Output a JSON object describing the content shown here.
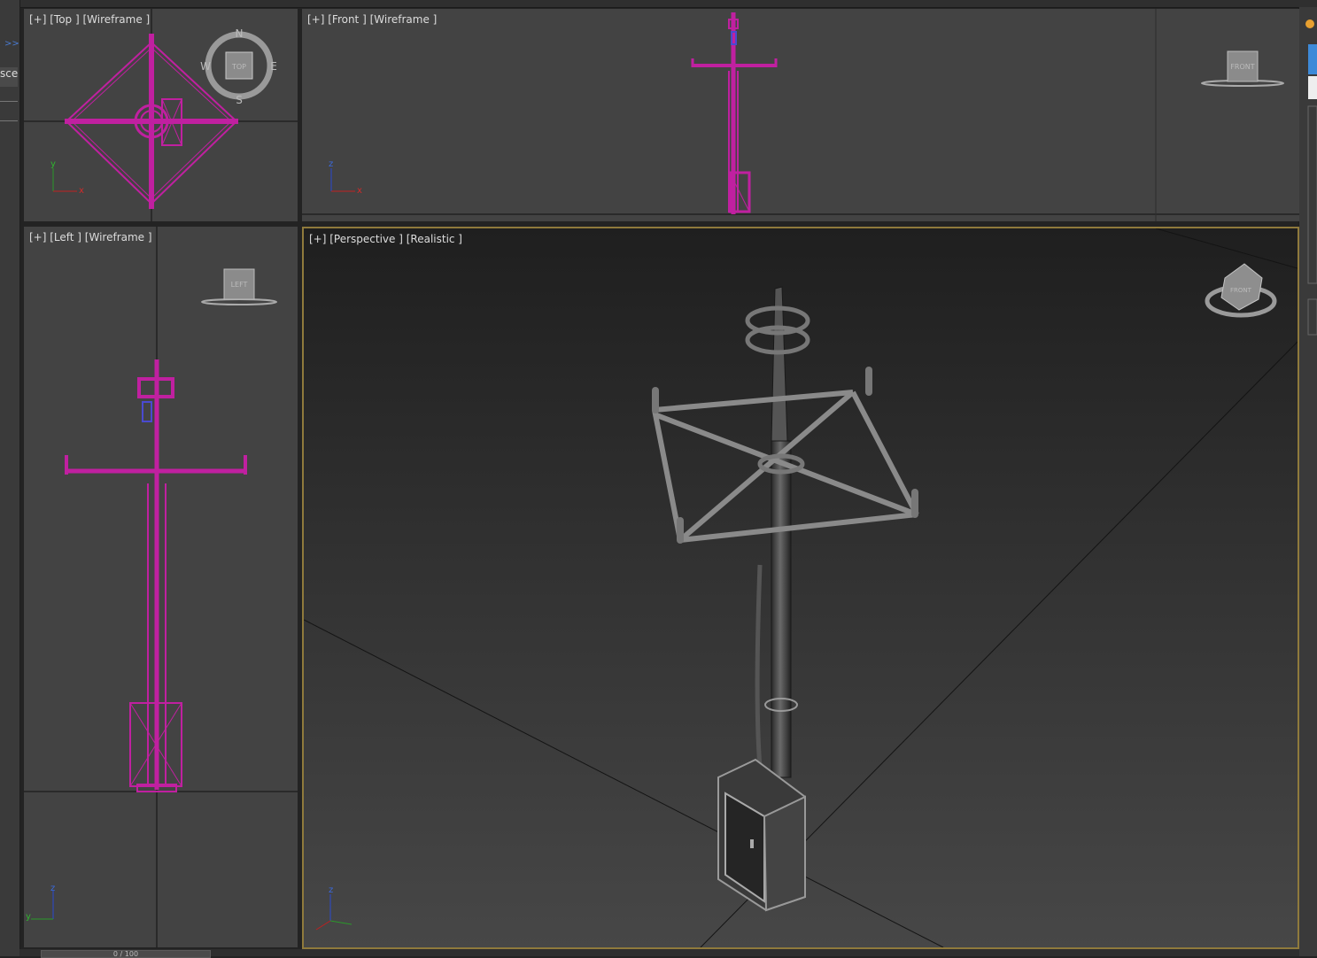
{
  "viewports": {
    "top": {
      "label": "[+] [Top ] [Wireframe ]",
      "gizmo": "TOP",
      "compass": {
        "n": "N",
        "s": "S",
        "e": "E",
        "w": "W"
      },
      "axes": {
        "up": "y",
        "right": "x"
      }
    },
    "front": {
      "label": "[+] [Front ] [Wireframe ]",
      "gizmo": "FRONT",
      "axes": {
        "up": "z",
        "right": "x"
      }
    },
    "left": {
      "label": "[+] [Left ] [Wireframe ]",
      "gizmo": "LEFT",
      "axes": {
        "up": "z",
        "right": "y"
      }
    },
    "perspective": {
      "label": "[+] [Perspective ] [Realistic ]",
      "gizmo": "FRONT",
      "axes": {
        "up": "z"
      }
    }
  },
  "left_panel": {
    "tab": "scer",
    "arrows": ">>"
  },
  "timeline": {
    "slider": "0 / 100"
  },
  "colors": {
    "wireframe": "#c020a0",
    "active_border": "#8f7a3c",
    "viewport_bg": "#434343",
    "grid": "#111111"
  },
  "icons": [
    "viewcube-icon",
    "compass-icon",
    "axis-tripod-icon"
  ]
}
